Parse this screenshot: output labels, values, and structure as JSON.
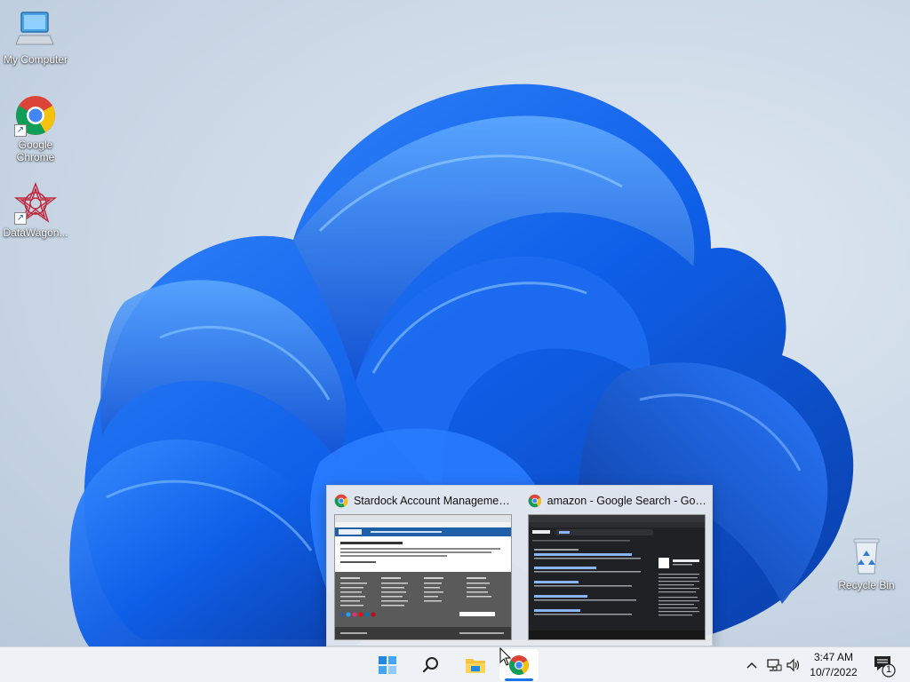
{
  "desktop": {
    "icons": [
      {
        "label": "My Computer",
        "icon": "computer-icon"
      },
      {
        "label": "Google\nChrome",
        "icon": "chrome-icon"
      },
      {
        "label": "DataWagon...",
        "icon": "datawagon-icon"
      },
      {
        "label": "Recycle Bin",
        "icon": "recycle-bin-icon"
      }
    ]
  },
  "thumbnails": [
    {
      "title": "Stardock Account Managemen...",
      "app_icon": "chrome-icon"
    },
    {
      "title": "amazon - Google Search - Goo...",
      "app_icon": "chrome-icon"
    }
  ],
  "taskbar": {
    "buttons": [
      {
        "name": "start",
        "icon": "windows-start-icon"
      },
      {
        "name": "search",
        "icon": "search-icon"
      },
      {
        "name": "file-explorer",
        "icon": "folder-icon"
      },
      {
        "name": "chrome",
        "icon": "chrome-icon",
        "active": true
      }
    ],
    "tray": {
      "chevron": "^",
      "clock_time": "3:47 AM",
      "clock_date": "10/7/2022",
      "notification_count": "1"
    }
  },
  "colors": {
    "accent": "#1a73e8",
    "taskbar_bg": "#eef1f5",
    "wallpaper_blue": "#1565e0"
  }
}
